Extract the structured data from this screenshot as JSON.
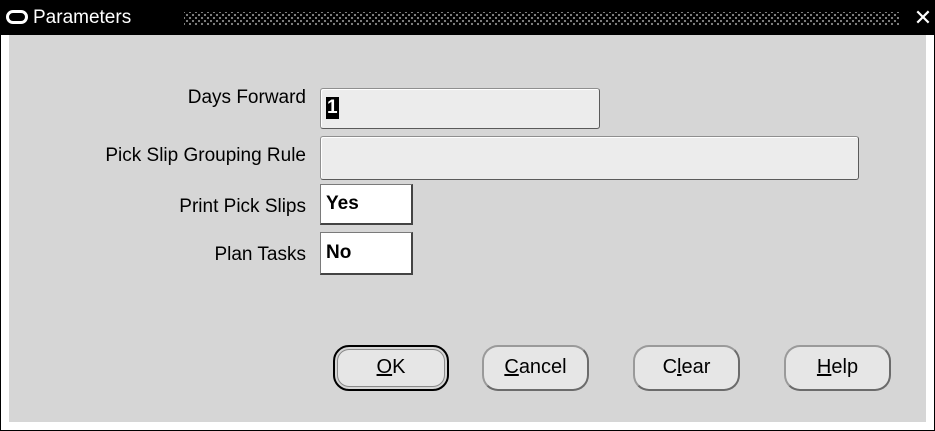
{
  "window": {
    "title": "Parameters",
    "close_glyph": "✕"
  },
  "fields": [
    {
      "label": "Days Forward",
      "value": "1"
    },
    {
      "label": "Pick Slip Grouping Rule",
      "value": ""
    },
    {
      "label": "Print Pick Slips",
      "value": "Yes"
    },
    {
      "label": "Plan Tasks",
      "value": "No"
    }
  ],
  "buttons": {
    "ok": {
      "mnemonic": "O",
      "rest": "K"
    },
    "cancel": {
      "mnemonic": "C",
      "rest": "ancel"
    },
    "clear": {
      "pre": "C",
      "mnemonic": "l",
      "rest": "ear"
    },
    "help": {
      "mnemonic": "H",
      "rest": "elp"
    }
  }
}
